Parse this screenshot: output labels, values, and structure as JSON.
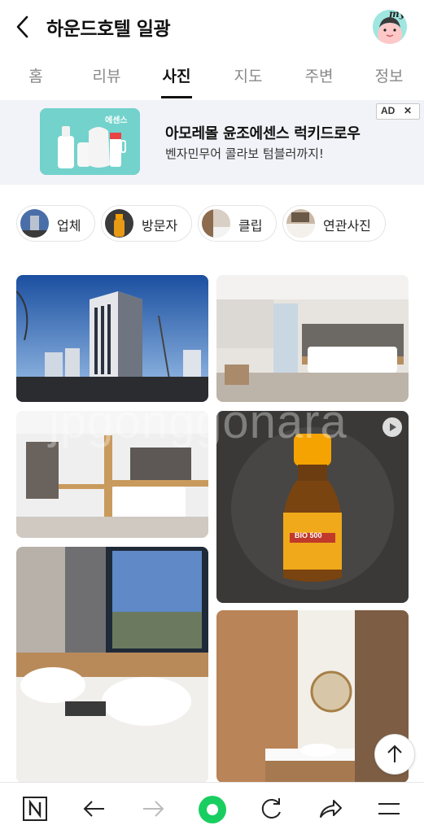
{
  "header": {
    "title": "하운드호텔 일광",
    "back_icon": "chevron-left-icon",
    "avatar_text": "my"
  },
  "tabs": [
    {
      "label": "홈",
      "active": false
    },
    {
      "label": "리뷰",
      "active": false
    },
    {
      "label": "사진",
      "active": true
    },
    {
      "label": "지도",
      "active": false
    },
    {
      "label": "주변",
      "active": false
    },
    {
      "label": "정보",
      "active": false
    }
  ],
  "ad": {
    "title": "아모레몰 윤조에센스 럭키드로우",
    "subtitle": "벤자민무어 콜라보 텀블러까지!",
    "badge": "AD",
    "badge_close": "✕",
    "image_caption": "에센스",
    "accent": "#73d2cc"
  },
  "chips": [
    {
      "label": "업체"
    },
    {
      "label": "방문자"
    },
    {
      "label": "클립"
    },
    {
      "label": "연관사진"
    }
  ],
  "photos": {
    "watermark": "jpgonggonara",
    "bottle_label": "BIO 500"
  },
  "bottom_nav": {
    "items": [
      "naver-n-icon",
      "back-arrow-icon",
      "forward-arrow-icon",
      "home-green-icon",
      "refresh-icon",
      "share-icon",
      "menu-icon"
    ],
    "home_color": "#19ce60"
  }
}
